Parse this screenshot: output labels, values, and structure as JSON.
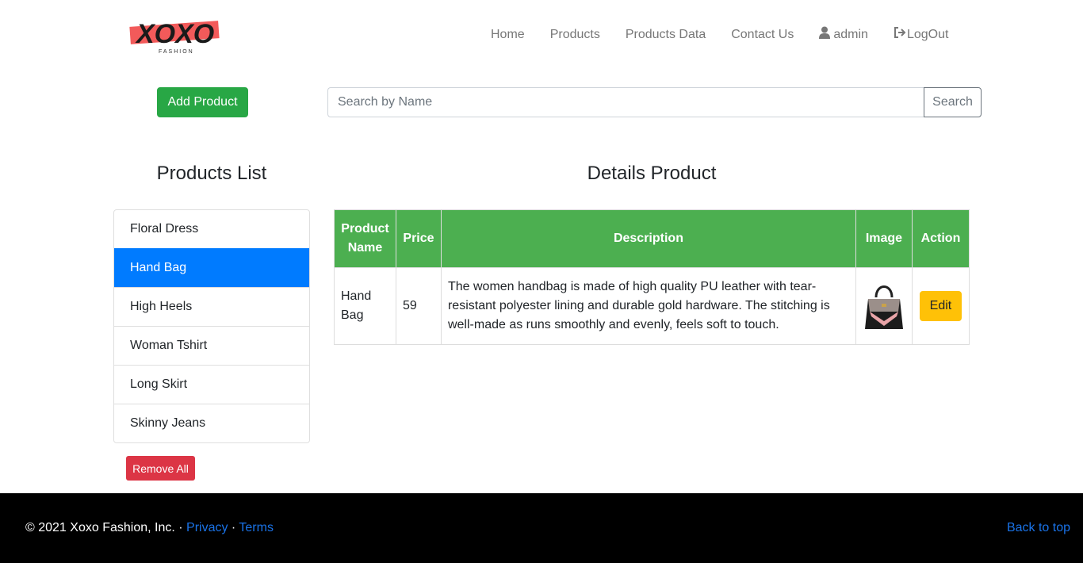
{
  "brand": {
    "logo_text": "XOXO",
    "logo_sub": "FASHION"
  },
  "nav": {
    "home": "Home",
    "products": "Products",
    "products_data": "Products Data",
    "contact": "Contact Us",
    "user": "admin",
    "logout": "LogOut"
  },
  "toolbar": {
    "add_label": "Add Product",
    "search_placeholder": "Search by Name",
    "search_label": "Search"
  },
  "list": {
    "heading": "Products List",
    "items": [
      "Floral Dress",
      "Hand Bag",
      "High Heels",
      "Woman Tshirt",
      "Long Skirt",
      "Skinny Jeans"
    ],
    "selected_index": 1,
    "remove_all_label": "Remove All"
  },
  "details": {
    "heading": "Details Product",
    "columns": [
      "Product Name",
      "Price",
      "Description",
      "Image",
      "Action"
    ],
    "row": {
      "name": "Hand Bag",
      "price": "59",
      "description": "The women handbag is made of high quality PU leather with tear-resistant polyester lining and durable gold hardware. The stitching is well-made as runs smoothly and evenly, feels soft to touch.",
      "image_icon": "handbag-thumbnail",
      "action_label": "Edit"
    }
  },
  "footer": {
    "copyright": "© 2021 Xoxo Fashion, Inc. ·",
    "privacy": "Privacy",
    "sep": "·",
    "terms": "Terms",
    "back_to_top": "Back to top"
  },
  "colors": {
    "primary": "#007bff",
    "success": "#28a745",
    "table_header": "#4caf50",
    "danger": "#dc3545",
    "warning": "#ffc107",
    "link": "#1a73e8",
    "footer_bg": "#000000"
  }
}
